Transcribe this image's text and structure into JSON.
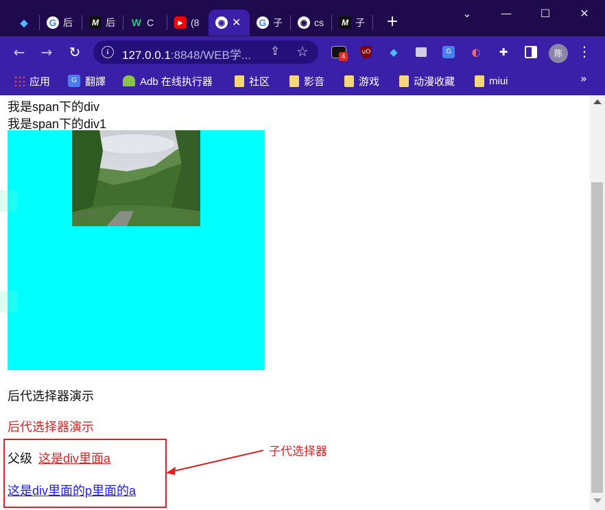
{
  "browser": {
    "tabs": [
      {
        "icon": "diamond-icon",
        "title": ""
      },
      {
        "icon": "google-icon",
        "title": "后"
      },
      {
        "icon": "m-logo-icon",
        "title": "后"
      },
      {
        "icon": "w-logo-icon",
        "title": "C"
      },
      {
        "icon": "youtube-icon",
        "title": "(8"
      },
      {
        "icon": "globe-icon",
        "title": "",
        "active": true
      },
      {
        "icon": "google-icon",
        "title": "子"
      },
      {
        "icon": "globe-icon",
        "title": "cs"
      },
      {
        "icon": "m-logo-icon",
        "title": "子"
      }
    ],
    "tab_close": "✕",
    "new_tab": "+",
    "window_controls": {
      "minimize": "—",
      "maximize": "☐",
      "close": "✕"
    },
    "tabs_menu": "⌄"
  },
  "toolbar": {
    "back": "←",
    "forward": "→",
    "reload": "↻",
    "url_host": "127.0.0.1",
    "url_rest": ":8848/WEB学...",
    "info_icon": "i",
    "share": "⇪",
    "star": "☆",
    "ext_badge": "4",
    "avatar_text": "陈",
    "menu": "⋮"
  },
  "bookmarks": {
    "items": [
      {
        "icon": "apps-grid-icon",
        "label": "应用"
      },
      {
        "icon": "translate-icon",
        "label": "翻譯"
      },
      {
        "icon": "android-icon",
        "label": "Adb 在线执行器"
      },
      {
        "icon": "folder-icon",
        "label": "社区"
      },
      {
        "icon": "folder-icon",
        "label": "影音"
      },
      {
        "icon": "folder-icon",
        "label": "游戏"
      },
      {
        "icon": "folder-icon",
        "label": "动漫收藏"
      },
      {
        "icon": "folder-icon",
        "label": "miui"
      }
    ],
    "more": "»"
  },
  "page": {
    "line1": "我是span下的div",
    "line2": "我是span下的div1",
    "desc_black": "后代选择器演示",
    "desc_red": "后代选择器演示",
    "parent_label": "父级",
    "link_red": "这是div里面a",
    "link_blue": "这是div里面的p里面的a",
    "annotation": "子代选择器",
    "colors": {
      "cyan": "#00ffff",
      "red": "#dd2222",
      "blue": "#1a1aee"
    }
  }
}
